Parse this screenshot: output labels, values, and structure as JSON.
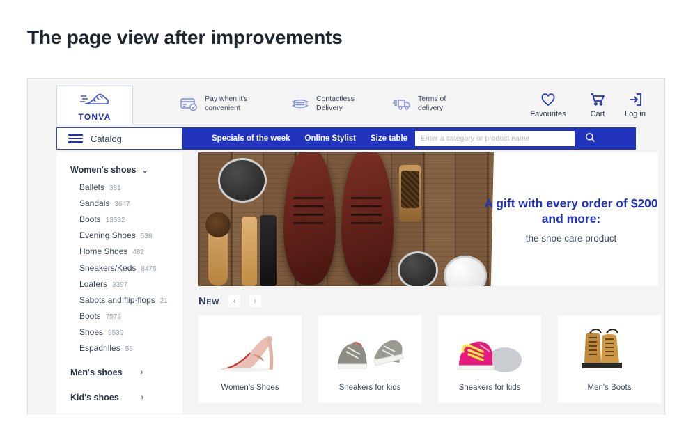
{
  "page_title": "The page view after improvements",
  "header": {
    "logo": {
      "name": "TONVA",
      "icon": "sneaker-icon"
    },
    "services": [
      {
        "icon": "credit-card-check-icon",
        "label": "Pay when it's\nconvenient"
      },
      {
        "icon": "face-mask-icon",
        "label": "Contactless\nDelivery"
      },
      {
        "icon": "delivery-truck-icon",
        "label": "Terms of\ndelivery"
      }
    ],
    "account": [
      {
        "icon": "heart-icon",
        "label": "Favourites"
      },
      {
        "icon": "cart-icon",
        "label": "Cart"
      },
      {
        "icon": "login-icon",
        "label": "Log in"
      }
    ]
  },
  "nav": {
    "catalog_label": "Catalog",
    "links": [
      "Specials of the week",
      "Online Stylist",
      "Size table"
    ],
    "search": {
      "placeholder": "Enter a category or product name",
      "value": ""
    }
  },
  "sidebar": {
    "groups": [
      {
        "label": "Women's shoes",
        "expanded": true,
        "chevron": "chevron-down-icon",
        "items": [
          {
            "label": "Ballets",
            "count": "381"
          },
          {
            "label": "Sandals",
            "count": "3647"
          },
          {
            "label": "Boots",
            "count": "13532"
          },
          {
            "label": "Evening Shoes",
            "count": "538"
          },
          {
            "label": "Home Shoes",
            "count": "482"
          },
          {
            "label": "Sneakers/Keds",
            "count": "8476"
          },
          {
            "label": "Loafers",
            "count": "3397"
          },
          {
            "label": "Sabots and flip-flops",
            "count": "21"
          },
          {
            "label": "Boots",
            "count": "7576"
          },
          {
            "label": "Shoes",
            "count": "9530"
          },
          {
            "label": "Espadrilles",
            "count": "55"
          }
        ]
      },
      {
        "label": "Men's shoes",
        "expanded": false,
        "chevron": "chevron-right-icon",
        "items": []
      },
      {
        "label": "Kid's shoes",
        "expanded": false,
        "chevron": "chevron-right-icon",
        "items": []
      }
    ]
  },
  "banner": {
    "headline": "A gift with every order\nof $200 and more:",
    "subline": "the shoe care product",
    "image_alt": "brown leather shoes with shoe care kit on wooden background"
  },
  "new_section": {
    "title": "New",
    "prev": "‹",
    "next": "›",
    "cards": [
      {
        "label": "Women's Shoes",
        "image": "pink-high-heel"
      },
      {
        "label": "Sneakers for kids",
        "image": "grey-sneakers"
      },
      {
        "label": "Sneakers for kids",
        "image": "pink-yellow-sneaker"
      },
      {
        "label": "Men's Boots",
        "image": "tan-leather-boots"
      }
    ]
  },
  "colors": {
    "brand_blue": "#2233bb",
    "page_bg": "#f4f4f5",
    "text": "#3a4455"
  }
}
